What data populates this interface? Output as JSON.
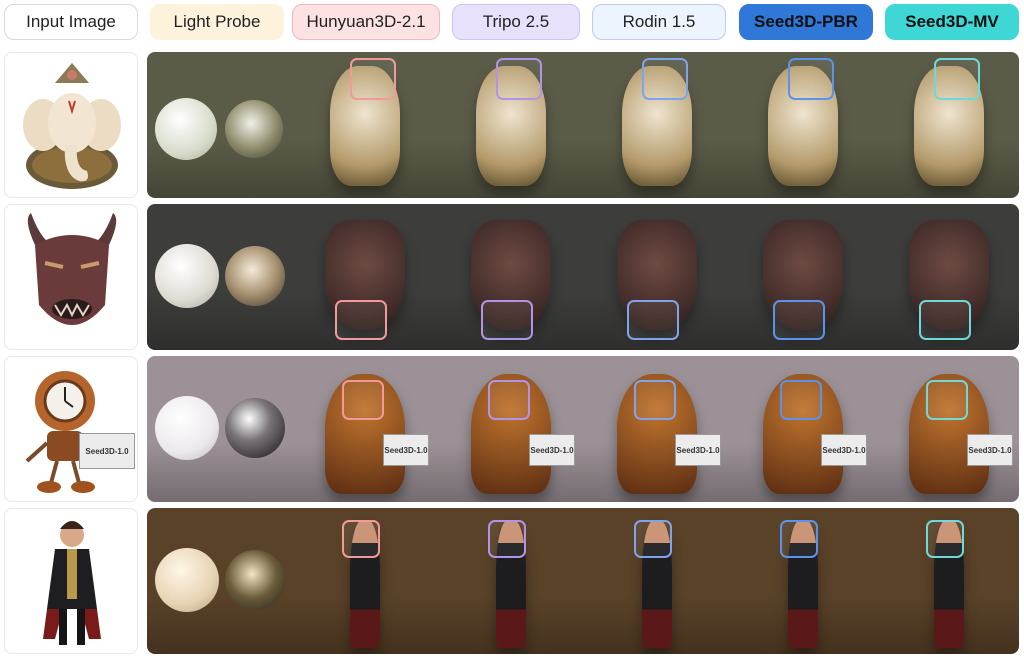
{
  "columns": [
    {
      "label": "Input Image",
      "bg": "#ffffff",
      "border": "#d9d9d9",
      "color": "#222222"
    },
    {
      "label": "Light Probe",
      "bg": "#fdf3dd",
      "border": "#fdf3dd",
      "color": "#222222"
    },
    {
      "label": "Hunyuan3D-2.1",
      "bg": "#fde2e4",
      "border": "#f4b7bd",
      "color": "#222222"
    },
    {
      "label": "Tripo 2.5",
      "bg": "#e8e1fb",
      "border": "#cfc2f4",
      "color": "#222222"
    },
    {
      "label": "Rodin 1.5",
      "bg": "#eef4fd",
      "border": "#b9cdee",
      "color": "#222222"
    },
    {
      "label": "Seed3D-PBR",
      "bg": "#2f78d8",
      "border": "#2f78d8",
      "color": "#111111"
    },
    {
      "label": "Seed3D-MV",
      "bg": "#3fd6d6",
      "border": "#3fd6d6",
      "color": "#111111"
    }
  ],
  "highlight_colors": [
    "#f29a9a",
    "#b393e6",
    "#7fa4ec",
    "#5b92ea",
    "#6fd8d8"
  ],
  "rows": [
    {
      "subject": "ganesha-statue",
      "scene_bg": "#5b5c48",
      "input_icon": "ganesha-icon"
    },
    {
      "subject": "oni-mask",
      "scene_bg": "#3d3e3c",
      "input_icon": "oni-mask-icon"
    },
    {
      "subject": "clock-robot",
      "scene_bg": "#9b9196",
      "input_icon": "clock-robot-icon",
      "sign_text": "Seed3D-1.0"
    },
    {
      "subject": "prince-character",
      "scene_bg": "#5a4229",
      "input_icon": "prince-icon"
    }
  ]
}
